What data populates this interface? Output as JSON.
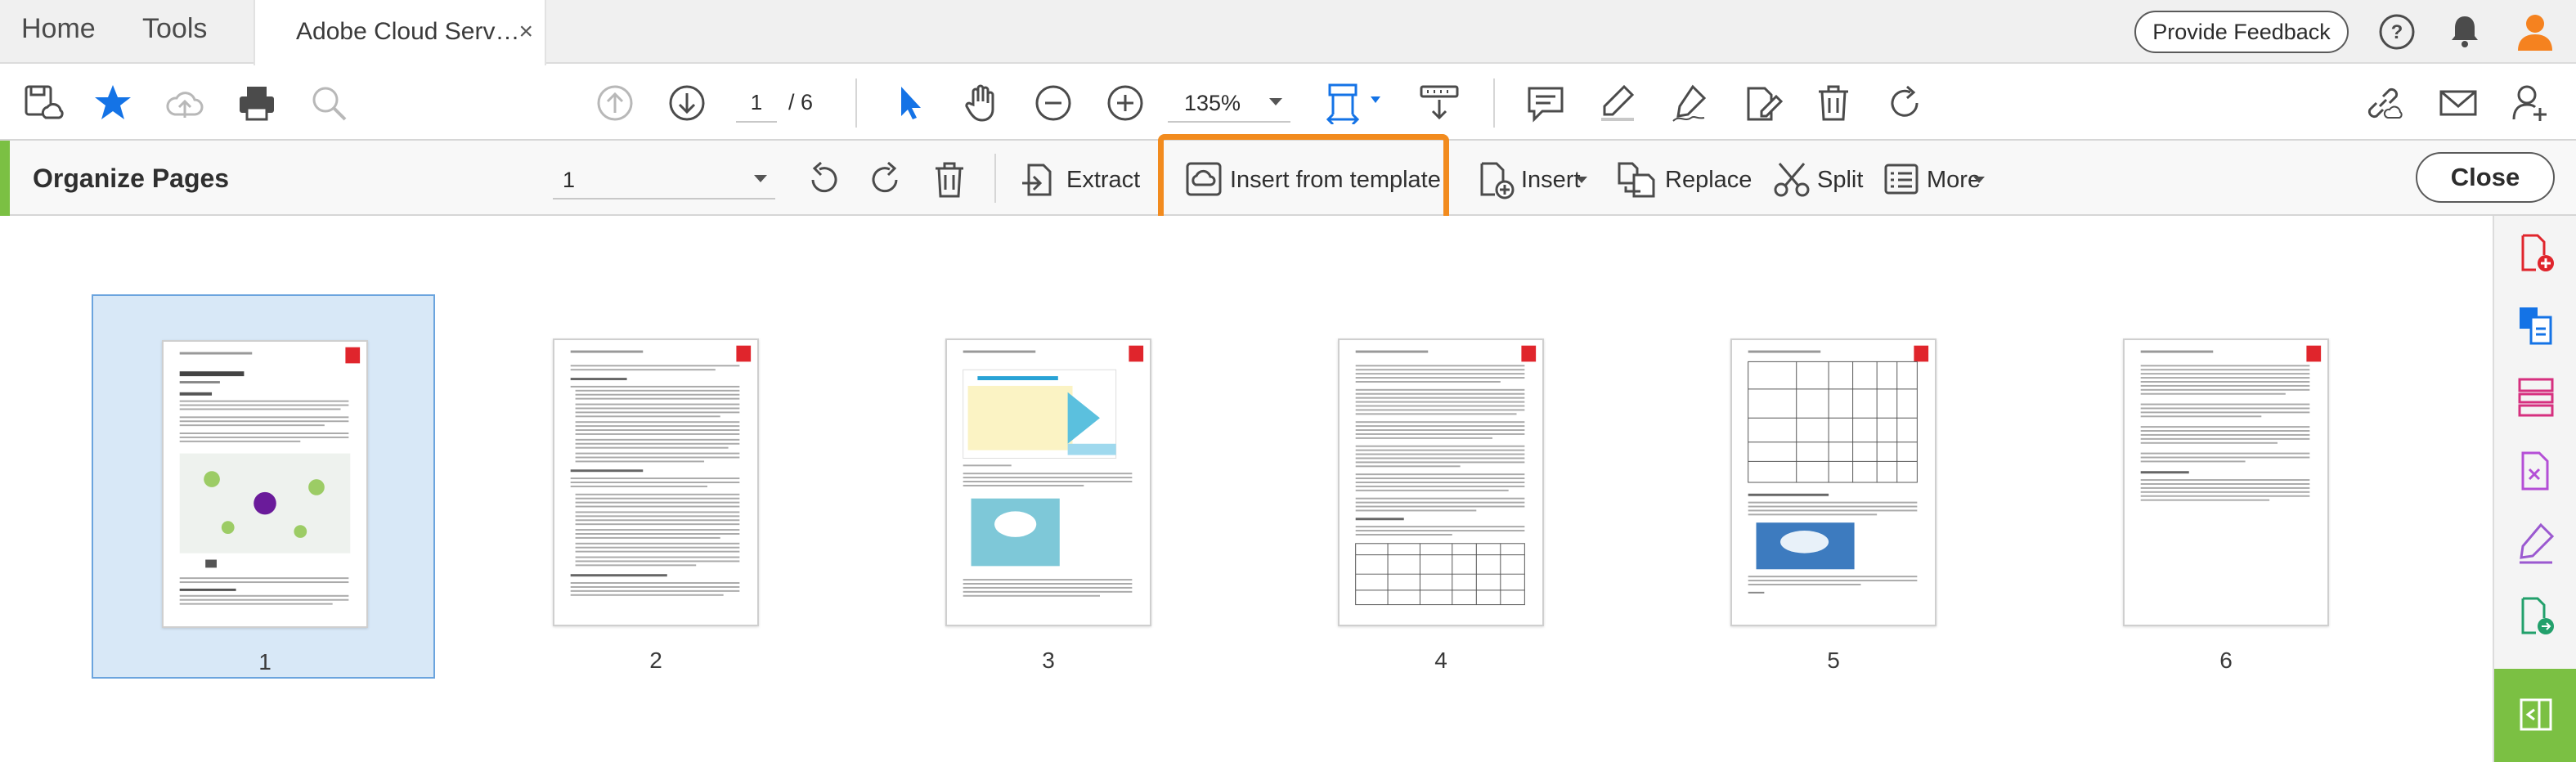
{
  "tabs": {
    "home": "Home",
    "tools": "Tools",
    "document": "Adobe Cloud Serv…",
    "close_glyph": "×"
  },
  "header": {
    "feedback_label": "Provide Feedback"
  },
  "toolbar": {
    "page_current": "1",
    "page_total": "/ 6",
    "zoom": "135%"
  },
  "organize": {
    "title": "Organize Pages",
    "page_select_value": "1",
    "extract_label": "Extract",
    "insert_template_label": "Insert from template",
    "insert_label": "Insert",
    "replace_label": "Replace",
    "split_label": "Split",
    "more_label": "More",
    "close_label": "Close"
  },
  "pages": [
    {
      "label": "1",
      "selected": true
    },
    {
      "label": "2",
      "selected": false
    },
    {
      "label": "3",
      "selected": false
    },
    {
      "label": "4",
      "selected": false
    },
    {
      "label": "5",
      "selected": false
    },
    {
      "label": "6",
      "selected": false
    }
  ],
  "colors": {
    "accent_green": "#7bc043",
    "highlight_orange": "#f28b1e",
    "selection_blue": "#d8e8f7",
    "brand_blue": "#1473e6",
    "adobe_red": "#e0252c",
    "avatar_orange": "#f5821f"
  }
}
